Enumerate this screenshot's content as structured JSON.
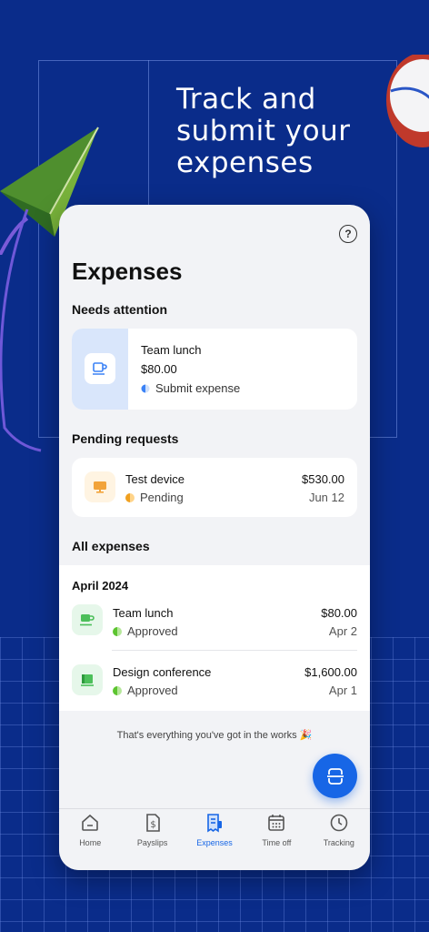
{
  "promo": {
    "headline": "Track and submit your expenses"
  },
  "screen": {
    "title": "Expenses",
    "help_glyph": "?",
    "needs_attention": {
      "heading": "Needs attention",
      "item": {
        "name": "Team lunch",
        "amount": "$80.00",
        "action": "Submit expense",
        "icon": "mug-icon"
      }
    },
    "pending": {
      "heading": "Pending requests",
      "item": {
        "name": "Test device",
        "status": "Pending",
        "amount": "$530.00",
        "date": "Jun 12",
        "icon": "monitor-icon"
      }
    },
    "all_expenses": {
      "heading": "All expenses",
      "month": "April 2024",
      "items": [
        {
          "name": "Team lunch",
          "status": "Approved",
          "amount": "$80.00",
          "date": "Apr 2",
          "icon": "mug-icon"
        },
        {
          "name": "Design conference",
          "status": "Approved",
          "amount": "$1,600.00",
          "date": "Apr 1",
          "icon": "book-icon"
        }
      ]
    },
    "footer_note": "That's everything you've got in the works 🎉"
  },
  "tabs": [
    {
      "label": "Home",
      "icon": "home-icon"
    },
    {
      "label": "Payslips",
      "icon": "payslip-icon"
    },
    {
      "label": "Expenses",
      "icon": "receipt-icon",
      "active": true
    },
    {
      "label": "Time off",
      "icon": "calendar-icon"
    },
    {
      "label": "Tracking",
      "icon": "clock-icon"
    }
  ],
  "colors": {
    "background": "#0a2c8a",
    "accent": "#1766e6",
    "status_pending": "#f0a020",
    "status_approved": "#5cc430",
    "status_submit": "#3b82f6"
  }
}
